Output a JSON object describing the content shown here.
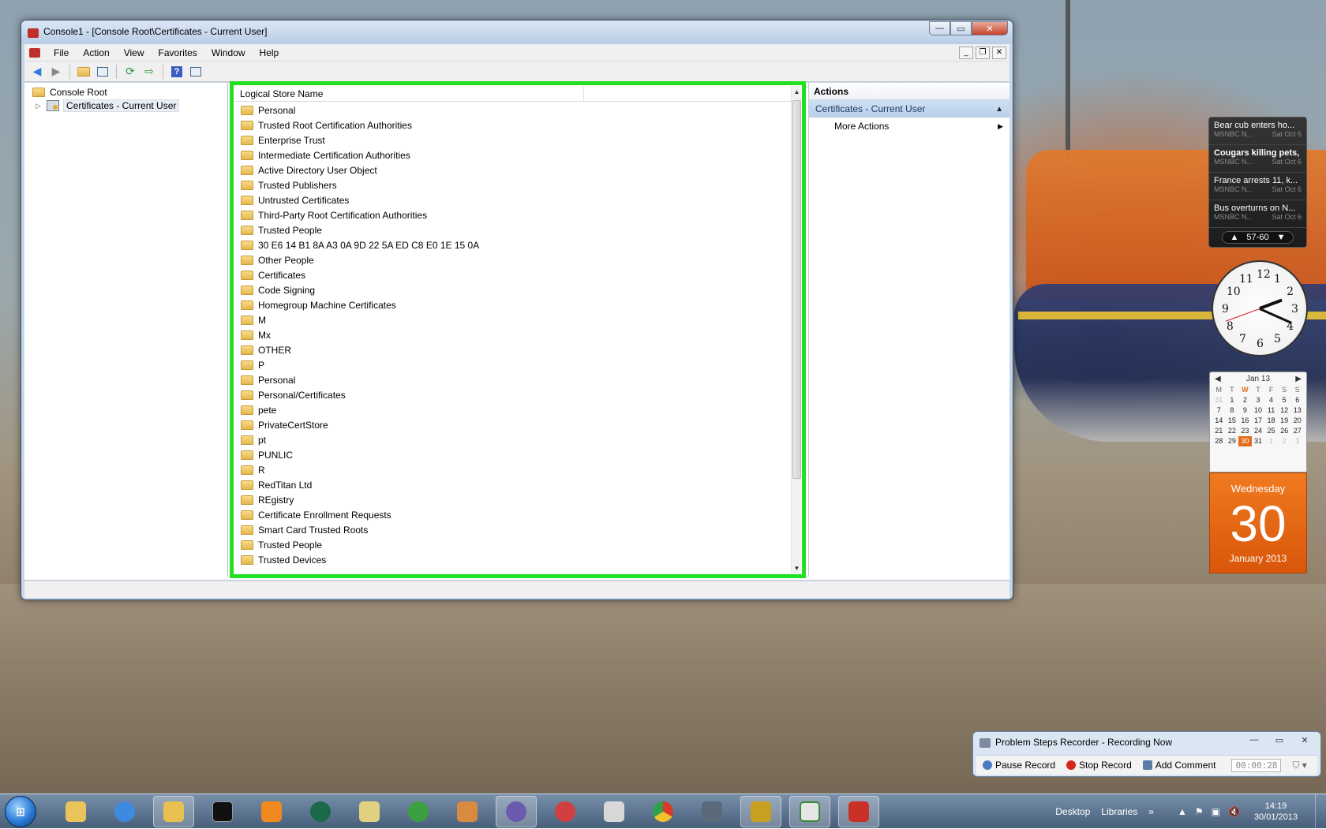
{
  "window": {
    "title": "Console1 - [Console Root\\Certificates - Current User]",
    "minimize": "—",
    "maximize": "▭",
    "close": "✕"
  },
  "menu": {
    "items": [
      "File",
      "Action",
      "View",
      "Favorites",
      "Window",
      "Help"
    ],
    "mdi_min": "_",
    "mdi_restore": "❐",
    "mdi_close": "✕"
  },
  "tree": {
    "root": "Console Root",
    "child": "Certificates - Current User"
  },
  "list": {
    "column_header": "Logical Store Name",
    "items": [
      "Personal",
      "Trusted Root Certification Authorities",
      "Enterprise Trust",
      "Intermediate Certification Authorities",
      "Active Directory User Object",
      "Trusted Publishers",
      "Untrusted Certificates",
      "Third-Party Root Certification Authorities",
      "Trusted People",
      "30 E6 14 B1 8A A3 0A 9D 22 5A ED C8 E0 1E 15 0A",
      "Other People",
      "Certificates",
      "Code Signing",
      "Homegroup Machine Certificates",
      "M",
      "Mx",
      "OTHER",
      "P",
      "Personal",
      "Personal/Certificates",
      "pete",
      "PrivateCertStore",
      "pt",
      "PUNLIC",
      "R",
      "RedTitan Ltd",
      "REgistry",
      "Certificate Enrollment Requests",
      "Smart Card Trusted Roots",
      "Trusted People",
      "Trusted Devices"
    ],
    "scroll_position": 0
  },
  "actions": {
    "header": "Actions",
    "section": "Certificates - Current User",
    "item": "More Actions"
  },
  "news": {
    "items": [
      {
        "headline": "Bear cub enters ho...",
        "source": "MSNBC N...",
        "date": "Sat Oct 6",
        "bold": false
      },
      {
        "headline": "Cougars killing pets, ...",
        "source": "MSNBC N...",
        "date": "Sat Oct 6",
        "bold": true
      },
      {
        "headline": "France arrests 11, k...",
        "source": "MSNBC N...",
        "date": "Sat Oct 6",
        "bold": false
      },
      {
        "headline": "Bus overturns on N...",
        "source": "MSNBC N...",
        "date": "Sat Oct 6",
        "bold": false
      }
    ],
    "pager": "57-60",
    "prev": "▲",
    "next": "▼"
  },
  "clock": {
    "numbers": [
      "12",
      "1",
      "2",
      "3",
      "4",
      "5",
      "6",
      "7",
      "8",
      "9",
      "10",
      "11"
    ],
    "hour": 2,
    "minute": 19
  },
  "calendar": {
    "month": "Jan 13",
    "prev": "◀",
    "next": "▶",
    "weekdays": [
      "M",
      "T",
      "W",
      "T",
      "F",
      "S",
      "S"
    ],
    "days": [
      "31",
      "1",
      "2",
      "3",
      "4",
      "5",
      "6",
      "7",
      "8",
      "9",
      "10",
      "11",
      "12",
      "13",
      "14",
      "15",
      "16",
      "17",
      "18",
      "19",
      "20",
      "21",
      "22",
      "23",
      "24",
      "25",
      "26",
      "27",
      "28",
      "29",
      "30",
      "31",
      "1",
      "2",
      "3"
    ],
    "today": "30",
    "weekday_name": "Wednesday",
    "big_day": "30",
    "month_year": "January 2013"
  },
  "psr": {
    "title": "Problem Steps Recorder - Recording Now",
    "pause": "Pause Record",
    "stop": "Stop Record",
    "comment": "Add Comment",
    "timer": "00:00:28"
  },
  "taskbar": {
    "start": "⊞",
    "links": [
      "Desktop",
      "Libraries"
    ],
    "overflow": "»",
    "time": "14:19",
    "date": "30/01/2013"
  },
  "colors": {
    "highlight": "#21e021",
    "calendar_accent": "#e56d1a"
  }
}
